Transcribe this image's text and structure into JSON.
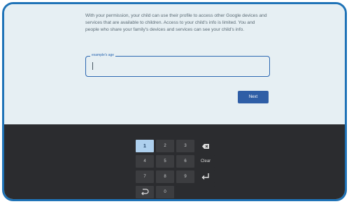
{
  "info_text": "With your permission, your child can use their profile to access other Google devices and services that are available to children. Access to your child's info is limited. You and people who share your family's devices and services can see your child's info.",
  "age_field": {
    "label": "example's age",
    "value": ""
  },
  "next_label": "Next",
  "keypad": {
    "keys": [
      "1",
      "2",
      "3",
      "4",
      "5",
      "6",
      "7",
      "8",
      "9",
      "0"
    ],
    "clear_label": "Clear",
    "active_key": "1",
    "icons": [
      "backspace-icon",
      "enter-icon",
      "hide-keyboard-icon"
    ]
  }
}
